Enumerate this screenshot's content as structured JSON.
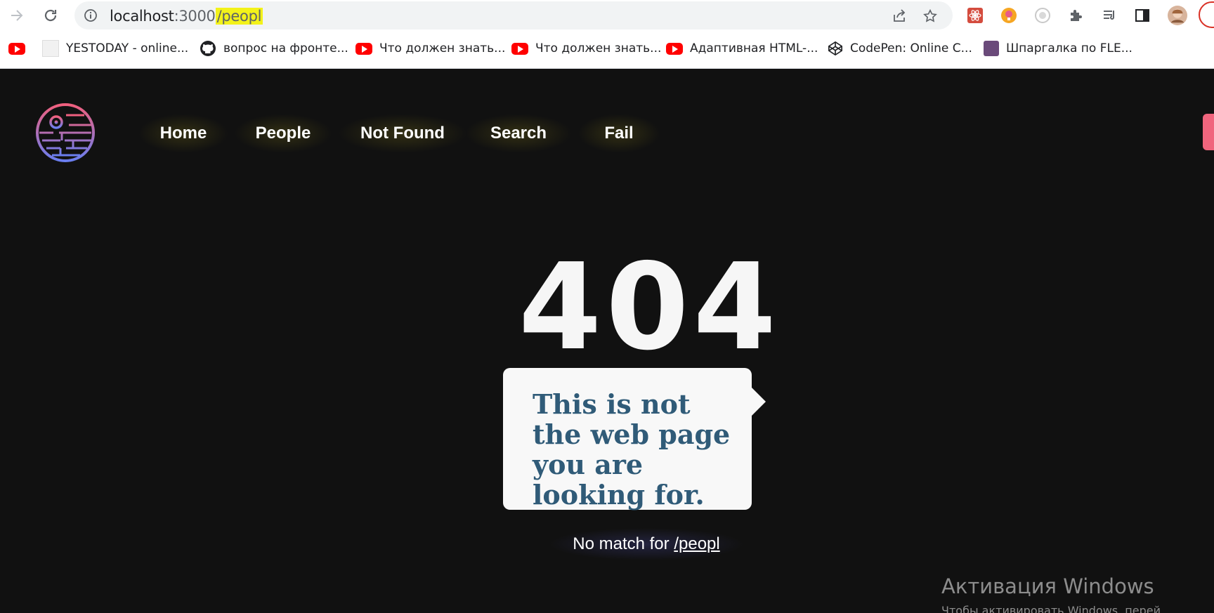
{
  "browser": {
    "url": {
      "host": "localhost",
      "port": ":3000",
      "path": "/peopl"
    },
    "bookmarks": [
      {
        "label": "",
        "icon": "youtube-icon"
      },
      {
        "label": "YESTODAY - online...",
        "icon": "site-icon"
      },
      {
        "label": "вопрос на фронте...",
        "icon": "github-icon"
      },
      {
        "label": "Что должен знать...",
        "icon": "youtube-icon"
      },
      {
        "label": "Что должен знать...",
        "icon": "youtube-icon"
      },
      {
        "label": "Адаптивная HTML-...",
        "icon": "youtube-icon"
      },
      {
        "label": "CodePen: Online C...",
        "icon": "codepen-icon"
      },
      {
        "label": "Шпаргалка по FLE...",
        "icon": "site-icon"
      }
    ]
  },
  "nav": {
    "items": [
      "Home",
      "People",
      "Not Found",
      "Search",
      "Fail"
    ]
  },
  "error": {
    "code": "404",
    "message": "This is not the web page you are looking for.",
    "no_match_prefix": "No match for",
    "path": "/peopl"
  },
  "os_watermark": {
    "title": "Активация Windows",
    "subtitle": "Чтобы активировать Windows, перей"
  },
  "colors": {
    "background": "#111111",
    "bubble_text": "#305b78",
    "url_highlight": "#f3f21a",
    "side_tab": "#f0657d"
  }
}
